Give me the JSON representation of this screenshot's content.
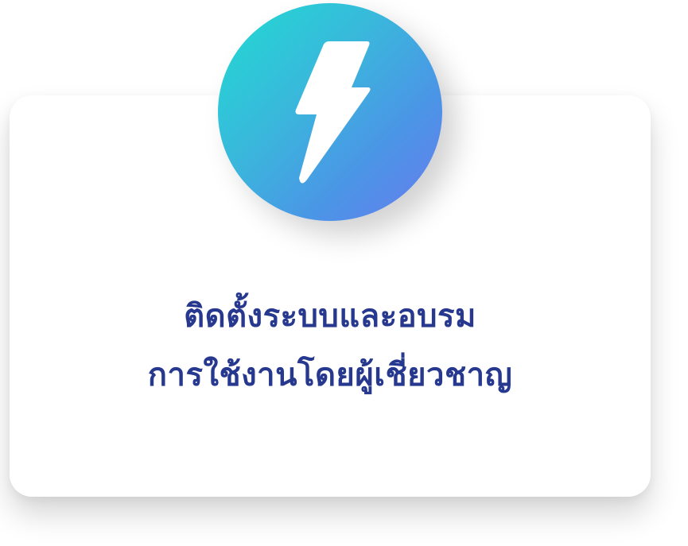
{
  "card": {
    "icon": "lightning-bolt-icon",
    "title_line_1": "ติดตั้งระบบและอบรม",
    "title_line_2": "การใช้งานโดยผู้เชี่ยวชาญ"
  },
  "colors": {
    "title_text": "#27388f",
    "gradient_start": "#1fdcd2",
    "gradient_end": "#6a7bef",
    "bolt": "#ffffff",
    "card_background": "#ffffff"
  }
}
